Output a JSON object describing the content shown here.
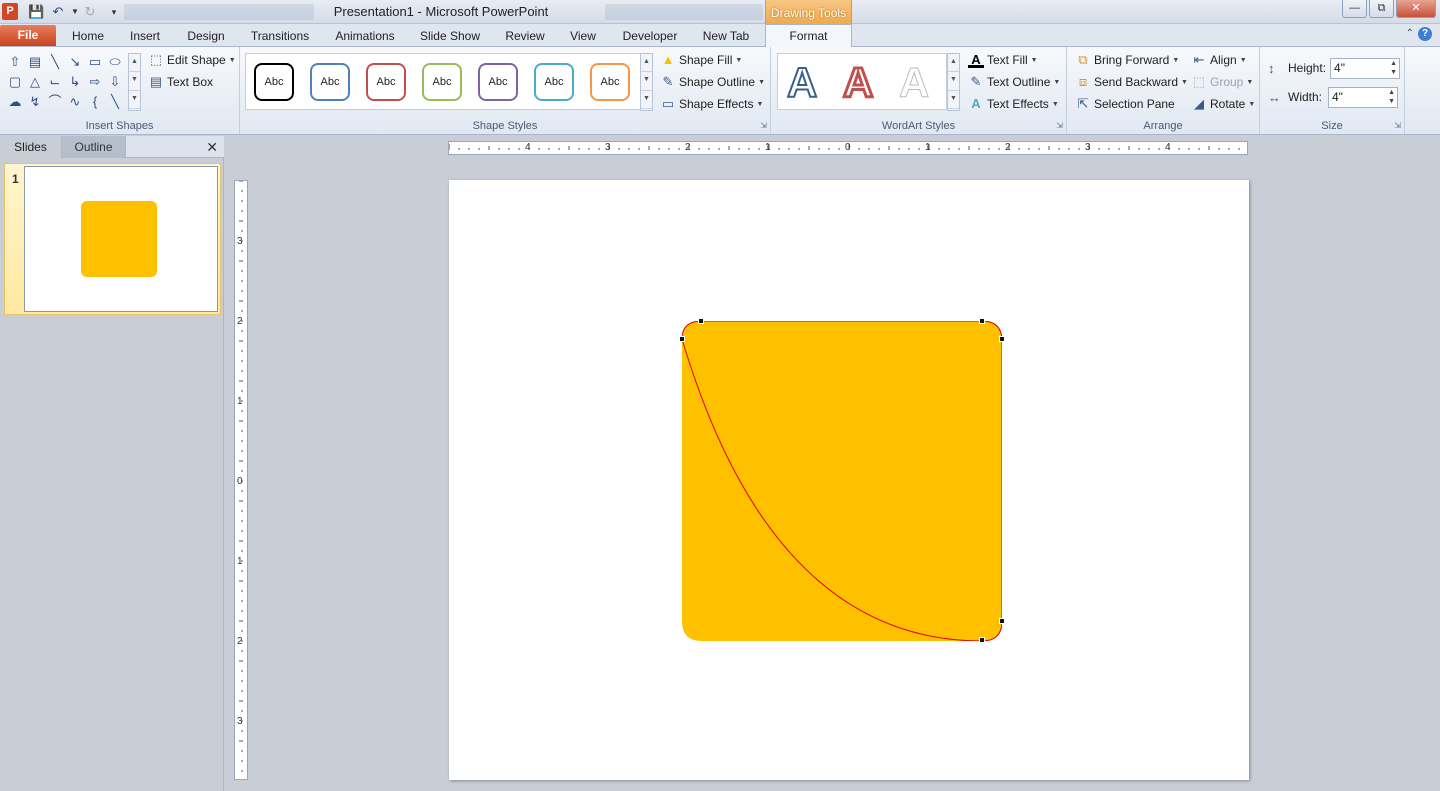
{
  "window": {
    "title": "Presentation1  -  Microsoft PowerPoint",
    "context_tab": "Drawing Tools"
  },
  "tabs": [
    "File",
    "Home",
    "Insert",
    "Design",
    "Transitions",
    "Animations",
    "Slide Show",
    "Review",
    "View",
    "Developer",
    "New Tab",
    "Format"
  ],
  "ribbon": {
    "insert_shapes": {
      "label": "Insert Shapes",
      "edit_shape": "Edit Shape",
      "text_box": "Text Box"
    },
    "shape_styles": {
      "label": "Shape Styles",
      "preview_text": "Abc",
      "style_colors": [
        "#000000",
        "#4f81bd",
        "#c0504d",
        "#9bbb59",
        "#8064a2",
        "#4bacc6",
        "#f79646"
      ],
      "shape_fill": "Shape Fill",
      "shape_outline": "Shape Outline",
      "shape_effects": "Shape Effects"
    },
    "wordart_styles": {
      "label": "WordArt Styles",
      "letter": "A",
      "text_fill": "Text Fill",
      "text_outline": "Text Outline",
      "text_effects": "Text Effects"
    },
    "arrange": {
      "label": "Arrange",
      "bring_forward": "Bring Forward",
      "send_backward": "Send Backward",
      "selection_pane": "Selection Pane",
      "align": "Align",
      "group": "Group",
      "rotate": "Rotate"
    },
    "size": {
      "label": "Size",
      "height_label": "Height:",
      "height_value": "4\"",
      "width_label": "Width:",
      "width_value": "4\""
    }
  },
  "left_pane": {
    "tab_slides": "Slides",
    "tab_outline": "Outline",
    "slide_number": "1"
  },
  "rulers": {
    "horizontal_labels": [
      "4",
      "3",
      "2",
      "1",
      "0",
      "1",
      "2",
      "3",
      "4"
    ],
    "vertical_labels": [
      "3",
      "2",
      "1",
      "0",
      "1",
      "2",
      "3"
    ]
  },
  "slide": {
    "shape_fill": "#ffc000",
    "shape_outline": "#e00000"
  }
}
